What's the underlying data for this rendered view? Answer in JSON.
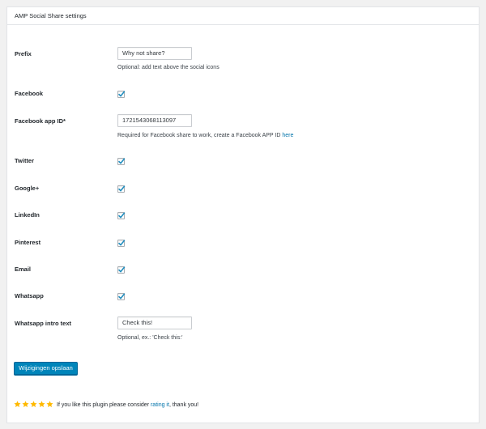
{
  "panel": {
    "title": "AMP Social Share settings"
  },
  "fields": {
    "prefix": {
      "label": "Prefix",
      "value": "Why not share?",
      "description": "Optional: add text above the social icons"
    },
    "facebook": {
      "label": "Facebook",
      "checked": true
    },
    "facebook_app_id": {
      "label": "Facebook app ID*",
      "value": "1721543068113097",
      "description_before": "Required for Facebook share to work, create a Facebook APP ID ",
      "description_link": "here"
    },
    "twitter": {
      "label": "Twitter",
      "checked": true
    },
    "googleplus": {
      "label": "Google+",
      "checked": true
    },
    "linkedin": {
      "label": "LinkedIn",
      "checked": true
    },
    "pinterest": {
      "label": "Pinterest",
      "checked": true
    },
    "email": {
      "label": "Email",
      "checked": true
    },
    "whatsapp": {
      "label": "Whatsapp",
      "checked": true
    },
    "whatsapp_intro": {
      "label": "Whatsapp intro text",
      "value": "Check this!",
      "description": "Optional, ex.: 'Check this:'"
    }
  },
  "actions": {
    "save_label": "Wijzigingen opslaan"
  },
  "footer": {
    "rating_stars": 5,
    "text_before": "If you like this plugin please consider ",
    "link_text": "rating it",
    "text_after": ", thank you!"
  },
  "colors": {
    "accent": "#0085ba",
    "link": "#0073aa",
    "star": "#ffb900",
    "checkmark": "#1e8cbe"
  }
}
